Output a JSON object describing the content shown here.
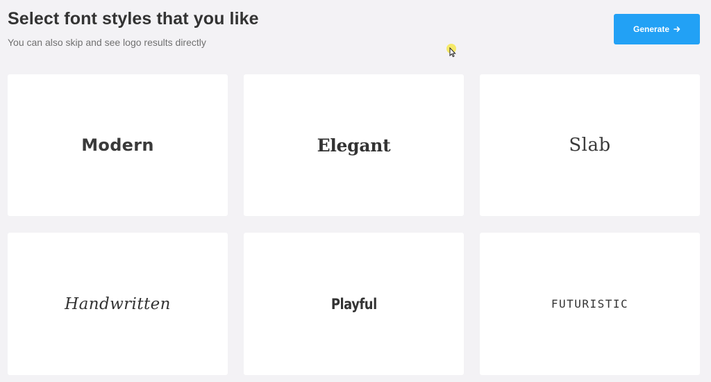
{
  "header": {
    "title": "Select font styles that you like",
    "subtitle": "You can also skip and see logo results directly"
  },
  "actions": {
    "generate_label": "Generate"
  },
  "icons": {
    "generate_arrow": "arrow-right-icon",
    "cursor": "mouse-pointer-icon"
  },
  "colors": {
    "accent": "#22a1f5",
    "background": "#f3f2f5",
    "card": "#ffffff",
    "text": "#333333",
    "subtext": "#707070"
  },
  "font_styles": [
    {
      "label": "Modern"
    },
    {
      "label": "Elegant"
    },
    {
      "label": "Slab"
    },
    {
      "label": "Handwritten"
    },
    {
      "label": "Playful"
    },
    {
      "label": "FUTURISTIC"
    }
  ]
}
